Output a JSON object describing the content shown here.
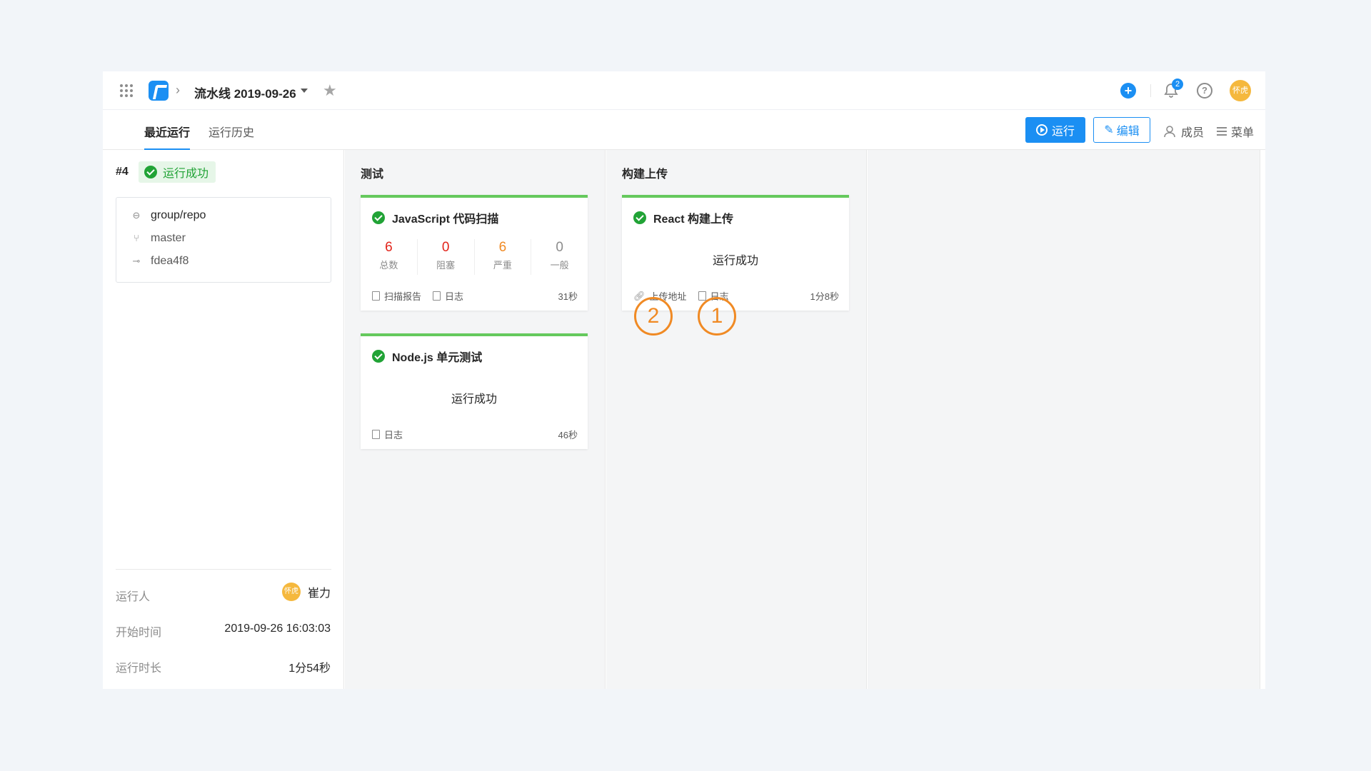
{
  "header": {
    "pipeline_title": "流水线 2019-09-26",
    "breadcrumb_sep": "›",
    "add_label": "+",
    "notification_count": "2",
    "help_label": "?",
    "avatar_text": "怀虎"
  },
  "tabs": {
    "recent": "最近运行",
    "history": "运行历史"
  },
  "actions": {
    "run": "运行",
    "edit": "编辑",
    "members": "成员",
    "menu": "菜单"
  },
  "run": {
    "number": "#4",
    "status": "运行成功",
    "repo": "group/repo",
    "branch": "master",
    "commit": "fdea4f8",
    "runner_label": "运行人",
    "runner_avatar": "怀虎",
    "runner_name": "崔力",
    "start_label": "开始时间",
    "start_value": "2019-09-26 16:03:03",
    "duration_label": "运行时长",
    "duration_value": "1分54秒"
  },
  "stages": [
    {
      "title": "测试",
      "jobs": [
        {
          "title": "JavaScript 代码扫描",
          "stats": [
            {
              "value": "6",
              "label": "总数"
            },
            {
              "value": "0",
              "label": "阻塞"
            },
            {
              "value": "6",
              "label": "严重"
            },
            {
              "value": "0",
              "label": "一般"
            }
          ],
          "link1": "扫描报告",
          "link2": "日志",
          "duration": "31秒"
        },
        {
          "title": "Node.js 单元测试",
          "status": "运行成功",
          "link1": "日志",
          "duration": "46秒"
        }
      ]
    },
    {
      "title": "构建上传",
      "jobs": [
        {
          "title": "React 构建上传",
          "status": "运行成功",
          "link1": "上传地址",
          "link2": "日志",
          "duration": "1分8秒"
        }
      ]
    }
  ],
  "callouts": {
    "upload": "2",
    "log": "1"
  },
  "colors": {
    "primary": "#1b8ff3",
    "success": "#21a336",
    "card_top": "#65c95d",
    "danger": "#e2231a",
    "warning": "#f08a24"
  }
}
